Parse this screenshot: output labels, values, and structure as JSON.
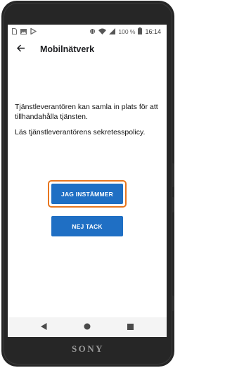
{
  "device": {
    "brand": "SONY"
  },
  "status_bar": {
    "left_icons": [
      "sim-icon",
      "image-icon",
      "play-store-icon"
    ],
    "right_icons": [
      "vibrate-icon",
      "wifi-icon",
      "signal-icon"
    ],
    "battery_percent": "100 %",
    "time": "16:14"
  },
  "app_bar": {
    "title": "Mobilnätverk",
    "back_icon": "arrow-back-icon"
  },
  "content": {
    "message_1": "Tjänstleverantören kan samla in plats för att tillhandahålla tjänsten.",
    "message_2": "Läs tjänstleverantörens sekretesspolicy."
  },
  "buttons": {
    "accept_label": "JAG INSTÄMMER",
    "decline_label": "NEJ TACK"
  },
  "nav_bar": {
    "icons": [
      "back-triangle-icon",
      "home-circle-icon",
      "recents-square-icon"
    ]
  },
  "colors": {
    "primary_button": "#1f6fc4",
    "focus_ring": "#e8761e",
    "device_body": "#262626"
  }
}
